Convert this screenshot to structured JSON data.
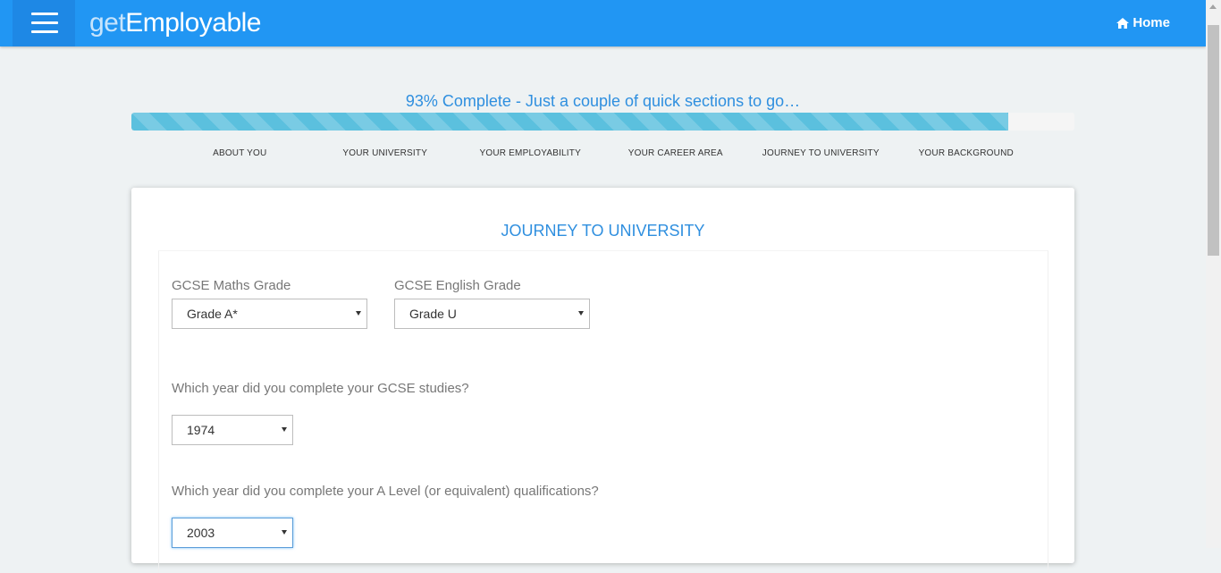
{
  "header": {
    "brand_light": "get",
    "brand_bold": "Employable",
    "home_label": "Home",
    "icons": {
      "menu": "hamburger-icon",
      "home": "home-icon"
    }
  },
  "progress": {
    "text": "93% Complete - Just a couple of quick sections to go…",
    "percent": 93,
    "color": "#5bc0de"
  },
  "steps": [
    "ABOUT YOU",
    "YOUR UNIVERSITY",
    "YOUR EMPLOYABILITY",
    "YOUR CAREER AREA",
    "JOURNEY TO UNIVERSITY",
    "YOUR BACKGROUND"
  ],
  "form": {
    "title": "JOURNEY TO UNIVERSITY",
    "maths": {
      "label": "GCSE Maths Grade",
      "value": "Grade A*"
    },
    "english": {
      "label": "GCSE English Grade",
      "value": "Grade U"
    },
    "gcse_year": {
      "label": "Which year did you complete your GCSE studies?",
      "value": "1974"
    },
    "alevel_year": {
      "label": "Which year did you complete your A Level (or equivalent) qualifications?",
      "value": "2003"
    }
  },
  "colors": {
    "accent": "#2196f3",
    "title": "#2f8fdf"
  }
}
